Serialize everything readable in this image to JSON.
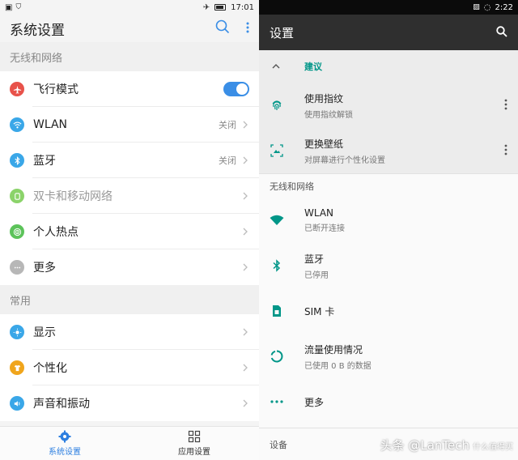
{
  "left": {
    "status": {
      "time": "17:01"
    },
    "title": "系统设置",
    "sections": [
      {
        "header": "无线和网络",
        "items": [
          {
            "label": "飞行模式",
            "type": "toggle",
            "icon": "airplane-icon",
            "color": "#e8524a"
          },
          {
            "label": "WLAN",
            "value": "关闭",
            "icon": "wifi-icon",
            "color": "#3aa7e8"
          },
          {
            "label": "蓝牙",
            "value": "关闭",
            "icon": "bluetooth-icon",
            "color": "#3aa7e8"
          },
          {
            "label": "双卡和移动网络",
            "icon": "sim-icon",
            "color": "#8bd36a",
            "dim": true
          },
          {
            "label": "个人热点",
            "icon": "hotspot-icon",
            "color": "#5cc35a"
          },
          {
            "label": "更多",
            "icon": "more-icon",
            "color": "#b7b7b7"
          }
        ]
      },
      {
        "header": "常用",
        "items": [
          {
            "label": "显示",
            "icon": "display-icon",
            "color": "#3aa7e8"
          },
          {
            "label": "个性化",
            "icon": "shirt-icon",
            "color": "#f0a51c"
          },
          {
            "label": "声音和振动",
            "icon": "sound-icon",
            "color": "#3aa7e8"
          }
        ]
      }
    ],
    "tabs": [
      {
        "label": "系统设置",
        "active": true
      },
      {
        "label": "应用设置",
        "active": false
      }
    ]
  },
  "right": {
    "status": {
      "time": "2:22"
    },
    "title": "设置",
    "suggest_label": "建议",
    "suggestions": [
      {
        "title": "使用指纹",
        "subtitle": "使用指纹解锁",
        "icon": "fingerprint-icon"
      },
      {
        "title": "更换壁纸",
        "subtitle": "对屏幕进行个性化设置",
        "icon": "wallpaper-icon"
      }
    ],
    "category": "无线和网络",
    "items": [
      {
        "title": "WLAN",
        "subtitle": "已断开连接",
        "icon": "wifi-icon"
      },
      {
        "title": "蓝牙",
        "subtitle": "已停用",
        "icon": "bluetooth-icon"
      },
      {
        "title": "SIM 卡",
        "subtitle": "",
        "icon": "sim-icon"
      },
      {
        "title": "流量使用情况",
        "subtitle": "已使用 0 B 的数据",
        "icon": "data-usage-icon"
      },
      {
        "title": "更多",
        "subtitle": "",
        "icon": "more-icon"
      }
    ],
    "footer_category": "设备",
    "accent": "#009688"
  },
  "watermark": {
    "text": "头条 @LanTech",
    "sub": "什么值得买"
  }
}
